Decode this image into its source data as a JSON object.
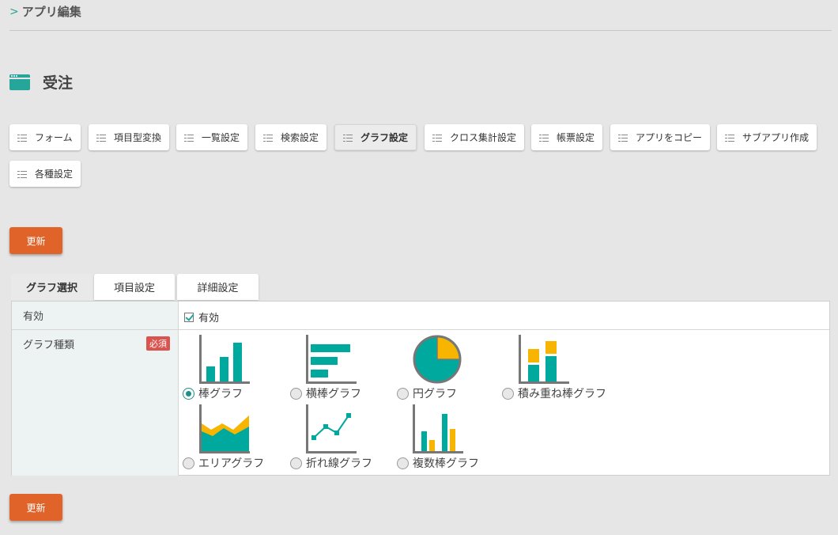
{
  "breadcrumb": {
    "label": "アプリ編集"
  },
  "page": {
    "title": "受注"
  },
  "toolbar": {
    "tabs": [
      {
        "label": "フォーム"
      },
      {
        "label": "項目型変換"
      },
      {
        "label": "一覧設定"
      },
      {
        "label": "検索設定"
      },
      {
        "label": "グラフ設定",
        "active": true
      },
      {
        "label": "クロス集計設定"
      },
      {
        "label": "帳票設定"
      },
      {
        "label": "アプリをコピー"
      },
      {
        "label": "サブアプリ作成"
      },
      {
        "label": "各種設定"
      }
    ]
  },
  "update_label": "更新",
  "sub_tabs": [
    {
      "label": "グラフ選択",
      "active": true
    },
    {
      "label": "項目設定"
    },
    {
      "label": "詳細設定"
    }
  ],
  "form": {
    "enabled": {
      "label": "有効",
      "checkbox_label": "有効",
      "checked": true
    },
    "graph_type": {
      "label": "グラフ種類",
      "required_badge": "必須",
      "options": [
        {
          "label": "棒グラフ",
          "icon": "bar-chart-icon",
          "selected": true
        },
        {
          "label": "横棒グラフ",
          "icon": "horizontal-bar-chart-icon"
        },
        {
          "label": "円グラフ",
          "icon": "pie-chart-icon"
        },
        {
          "label": "積み重ね棒グラフ",
          "icon": "stacked-bar-chart-icon"
        },
        {
          "label": "エリアグラフ",
          "icon": "area-chart-icon"
        },
        {
          "label": "折れ線グラフ",
          "icon": "line-chart-icon"
        },
        {
          "label": "複数棒グラフ",
          "icon": "multi-bar-chart-icon"
        }
      ]
    }
  },
  "colors": {
    "teal": "#00a99d",
    "yellow": "#f7b500",
    "orange": "#e0642a",
    "required": "#d9534f"
  }
}
